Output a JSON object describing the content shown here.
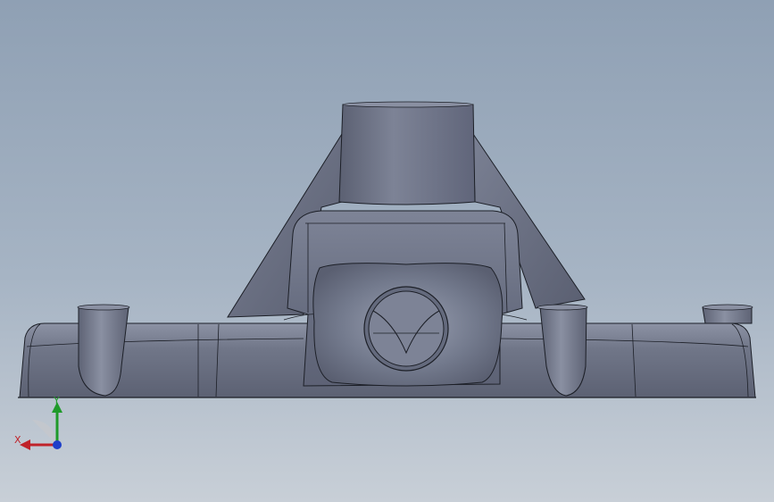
{
  "viewport": {
    "background_top": "#8fa0b4",
    "background_bottom": "#c8cfd7",
    "model_name": "cast-bracket-housing-front-view"
  },
  "model": {
    "body_color": "#6f7588",
    "edge_color": "#1c1f27",
    "highlight_color": "#9aa0b2"
  },
  "triad": {
    "y_label": "Y",
    "x_label": "X",
    "y_color": "#1f9a2a",
    "x_color": "#c0232a",
    "z_color": "#1d3ec9"
  }
}
